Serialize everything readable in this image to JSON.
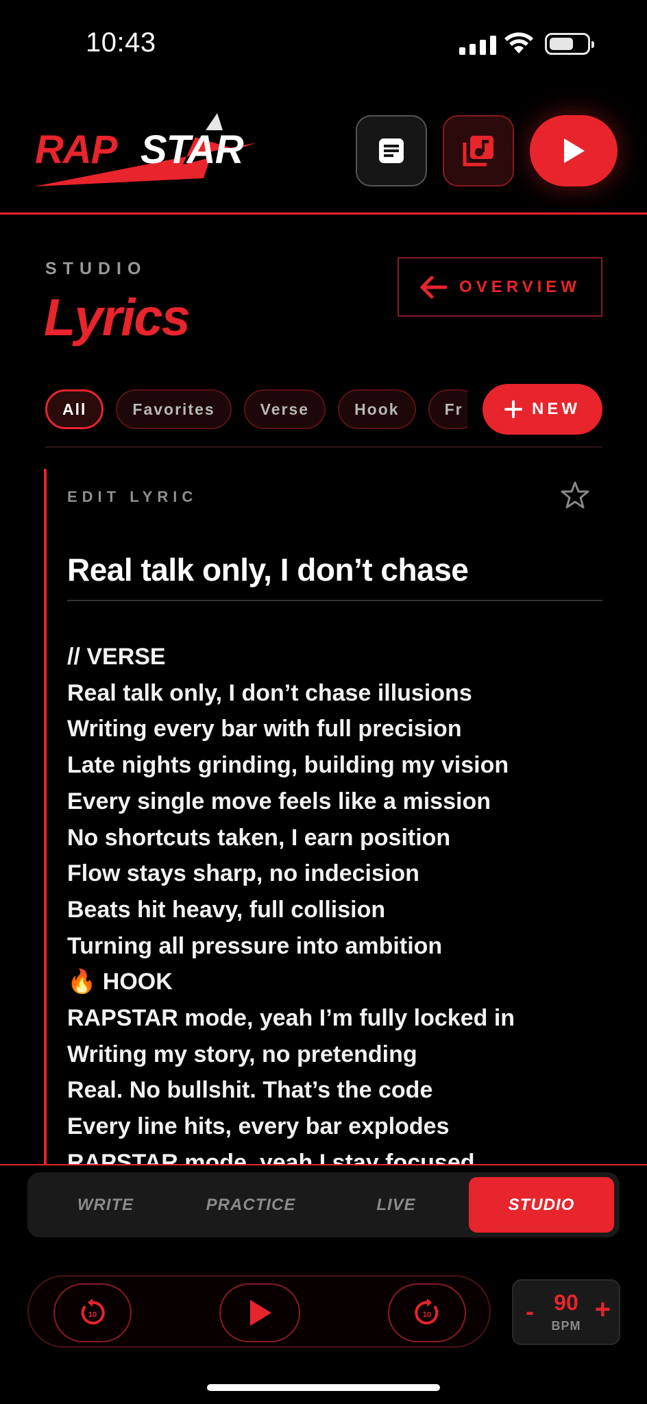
{
  "status_bar": {
    "time": "10:43"
  },
  "header": {
    "logo_text": "RAPSTAR",
    "accent_color": "#e8242c",
    "buttons": [
      {
        "name": "document",
        "icon": "document-icon"
      },
      {
        "name": "music-library",
        "icon": "music-library-icon"
      },
      {
        "name": "play",
        "icon": "play-icon"
      }
    ]
  },
  "section": {
    "label": "STUDIO",
    "title": "Lyrics",
    "overview_label": "OVERVIEW"
  },
  "filters": {
    "chips": [
      "All",
      "Favorites",
      "Verse",
      "Hook",
      "Fr"
    ],
    "active": "All",
    "new_label": "NEW"
  },
  "editor": {
    "label": "EDIT LYRIC",
    "title": "Real talk only, I don’t chase",
    "lines": [
      "// VERSE",
      "Real talk only, I don’t chase illusions",
      "Writing every bar with full precision",
      "Late nights grinding, building my vision",
      "Every single move feels like a mission",
      "No shortcuts taken, I earn position",
      "Flow stays sharp, no indecision",
      "Beats hit heavy, full collision",
      "Turning all pressure into ambition",
      "🔥 HOOK",
      "RAPSTAR mode, yeah I’m fully locked in",
      "Writing my story, no pretending",
      "Real. No bullshit. That’s the code",
      "Every line hits, every bar explodes",
      "RAPSTAR mode, yeah I stay focused"
    ]
  },
  "tabs": [
    {
      "label": "WRITE",
      "active": false
    },
    {
      "label": "PRACTICE",
      "active": false
    },
    {
      "label": "LIVE",
      "active": false
    },
    {
      "label": "STUDIO",
      "active": true
    }
  ],
  "transport": {
    "skip_back_seconds": "10",
    "skip_forward_seconds": "10"
  },
  "bpm": {
    "minus": "-",
    "value": "90",
    "unit": "BPM",
    "plus": "+"
  }
}
